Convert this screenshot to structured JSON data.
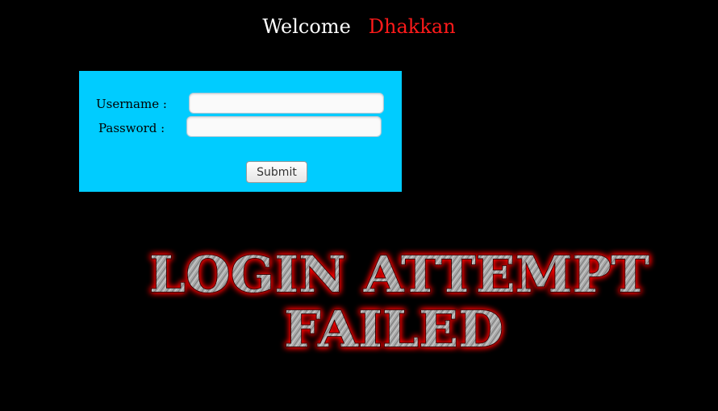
{
  "header": {
    "welcome_text": "Welcome",
    "user_name": "Dhakkan"
  },
  "login_form": {
    "username_label": "Username :",
    "username_value": "",
    "password_label": "Password :",
    "password_value": "",
    "submit_label": "Submit"
  },
  "status_banner": {
    "line1": "LOGIN ATTEMPT",
    "line2": "FAILED"
  },
  "colors": {
    "background": "#000000",
    "panel": "#00ccff",
    "user_name": "#ff1a1a",
    "banner_glow": "#ff0000"
  }
}
